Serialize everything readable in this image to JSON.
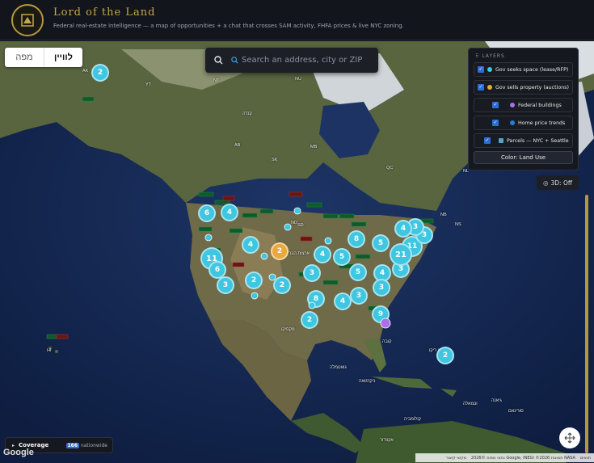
{
  "header": {
    "title": "Lord of the Land",
    "subtitle": "Federal real-estate intelligence — a map of opportunities + a chat that crosses SAM activity, FHFA prices & live NYC zoning."
  },
  "view_toggle": {
    "map_label": "מפה",
    "satellite_label": "לוויין"
  },
  "search": {
    "placeholder": "Search an address, city or ZIP"
  },
  "layers": {
    "title": "LAYERS",
    "items": [
      {
        "label": "Gov seeks space (lease/RFP)",
        "checked": true,
        "color": "#3fc6e0"
      },
      {
        "label": "Gov sells property (auctions)",
        "checked": true,
        "color": "#e8a83a"
      },
      {
        "label": "Federal buildings",
        "checked": true,
        "color": "#a970e8"
      },
      {
        "label": "Home price trends",
        "checked": true,
        "color": "#2b7bd6"
      },
      {
        "label": "Parcels — NYC + Seattle",
        "checked": true,
        "color": "#5aa0c8"
      }
    ],
    "color_button": "Color: Land Use"
  },
  "btn3d": {
    "label": "3D: Off"
  },
  "coverage": {
    "label": "Coverage",
    "count": "166",
    "suffix": "nationwide"
  },
  "attribution": {
    "terms": "תנאים",
    "data": "נתוני מפות ©2026 Google, INEGI ©2026 תמונות NASA",
    "shortcuts": "מקשי קיצור"
  },
  "google_label": "Google",
  "map_labels": [
    {
      "text": "AK"
    },
    {
      "text": "YT"
    },
    {
      "text": "NT"
    },
    {
      "text": "NU"
    },
    {
      "text": "קנדה"
    },
    {
      "text": "AB"
    },
    {
      "text": "SK"
    },
    {
      "text": "MB"
    },
    {
      "text": "QC"
    },
    {
      "text": "NL"
    },
    {
      "text": "ND"
    },
    {
      "text": "SD"
    },
    {
      "text": "NB"
    },
    {
      "text": "NS"
    },
    {
      "text": "HI"
    },
    {
      "text": "מקסיקו"
    },
    {
      "text": "קובה"
    },
    {
      "text": "פוארטו ריקו"
    },
    {
      "text": "גואטמלה"
    },
    {
      "text": "ניקרגואה"
    },
    {
      "text": "ונצואלה"
    },
    {
      "text": "קולומביה"
    },
    {
      "text": "אקוודור"
    },
    {
      "text": "גיאנה"
    },
    {
      "text": "סורינאם"
    },
    {
      "text": "ארצות הברית"
    }
  ],
  "clusters": [
    {
      "count": "2",
      "kind": "seek"
    },
    {
      "count": "6",
      "kind": "seek"
    },
    {
      "count": "4",
      "kind": "seek"
    },
    {
      "count": "4",
      "kind": "seek"
    },
    {
      "count": "2",
      "kind": "sell"
    },
    {
      "count": "11",
      "kind": "seek"
    },
    {
      "count": "6",
      "kind": "seek"
    },
    {
      "count": "3",
      "kind": "seek"
    },
    {
      "count": "2",
      "kind": "seek"
    },
    {
      "count": "2",
      "kind": "seek"
    },
    {
      "count": "3",
      "kind": "seek"
    },
    {
      "count": "4",
      "kind": "seek"
    },
    {
      "count": "8",
      "kind": "seek"
    },
    {
      "count": "5",
      "kind": "seek"
    },
    {
      "count": "5",
      "kind": "seek"
    },
    {
      "count": "5",
      "kind": "seek"
    },
    {
      "count": "4",
      "kind": "seek"
    },
    {
      "count": "3",
      "kind": "seek"
    },
    {
      "count": "3",
      "kind": "seek"
    },
    {
      "count": "11",
      "kind": "seek"
    },
    {
      "count": "21",
      "kind": "seek"
    },
    {
      "count": "3",
      "kind": "seek"
    },
    {
      "count": "3",
      "kind": "seek"
    },
    {
      "count": "4",
      "kind": "seek"
    },
    {
      "count": "8",
      "kind": "seek"
    },
    {
      "count": "3",
      "kind": "seek"
    },
    {
      "count": "4",
      "kind": "seek"
    },
    {
      "count": "2",
      "kind": "seek"
    },
    {
      "count": "9",
      "kind": "seek"
    },
    {
      "count": "2",
      "kind": "seek"
    }
  ],
  "colors": {
    "accent_gold": "#c9a54a",
    "seek": "#3fc6e0",
    "sell": "#e8a83a",
    "federal": "#a970e8"
  }
}
